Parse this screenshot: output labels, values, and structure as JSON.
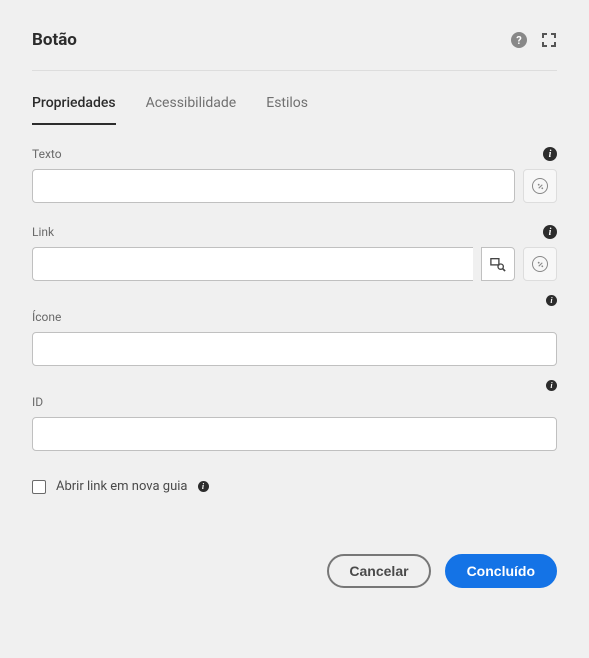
{
  "header": {
    "title": "Botão"
  },
  "tabs": {
    "properties": "Propriedades",
    "accessibility": "Acessibilidade",
    "styles": "Estilos"
  },
  "fields": {
    "text": {
      "label": "Texto",
      "value": ""
    },
    "link": {
      "label": "Link",
      "value": ""
    },
    "icon": {
      "label": "Ícone",
      "value": ""
    },
    "id": {
      "label": "ID",
      "value": ""
    }
  },
  "checkbox": {
    "newtab": "Abrir link em nova guia"
  },
  "footer": {
    "cancel": "Cancelar",
    "done": "Concluído"
  }
}
